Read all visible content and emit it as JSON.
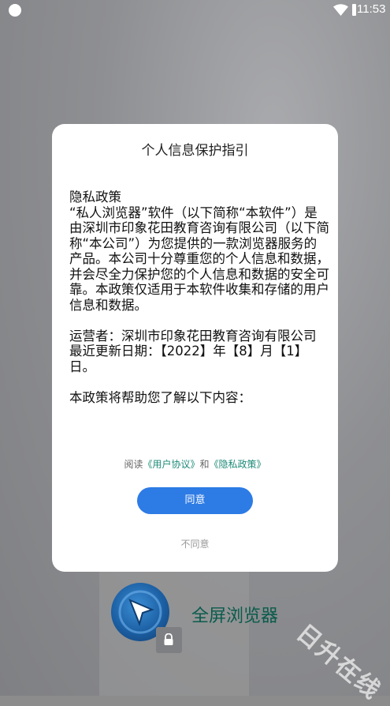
{
  "status_bar": {
    "time": "11:53"
  },
  "background": {
    "app_title": "全屏浏览器",
    "watermark": "日升在线"
  },
  "dialog": {
    "title": "个人信息保护指引",
    "policy_heading": "隐私政策",
    "paragraph1": "“私人浏览器”软件（以下简称“本软件”）是由深圳市印象花田教育咨询有限公司（以下简称“本公司”）为您提供的一款浏览器服务的产品。本公司十分尊重您的个人信息和数据，并会尽全力保护您的个人信息和数据的安全可靠。本政策仅适用于本软件收集和存储的用户信息和数据。",
    "operator": "运营者：深圳市印象花田教育咨询有限公司",
    "updated": "最近更新日期：【2022】年【8】月【1】日。",
    "intro": "本政策将帮助您了解以下内容：",
    "links": {
      "prefix": "阅读",
      "user_agreement": "《用户协议》",
      "and": "和",
      "privacy_policy": "《隐私政策》"
    },
    "agree_label": "同意",
    "disagree_label": "不同意"
  }
}
